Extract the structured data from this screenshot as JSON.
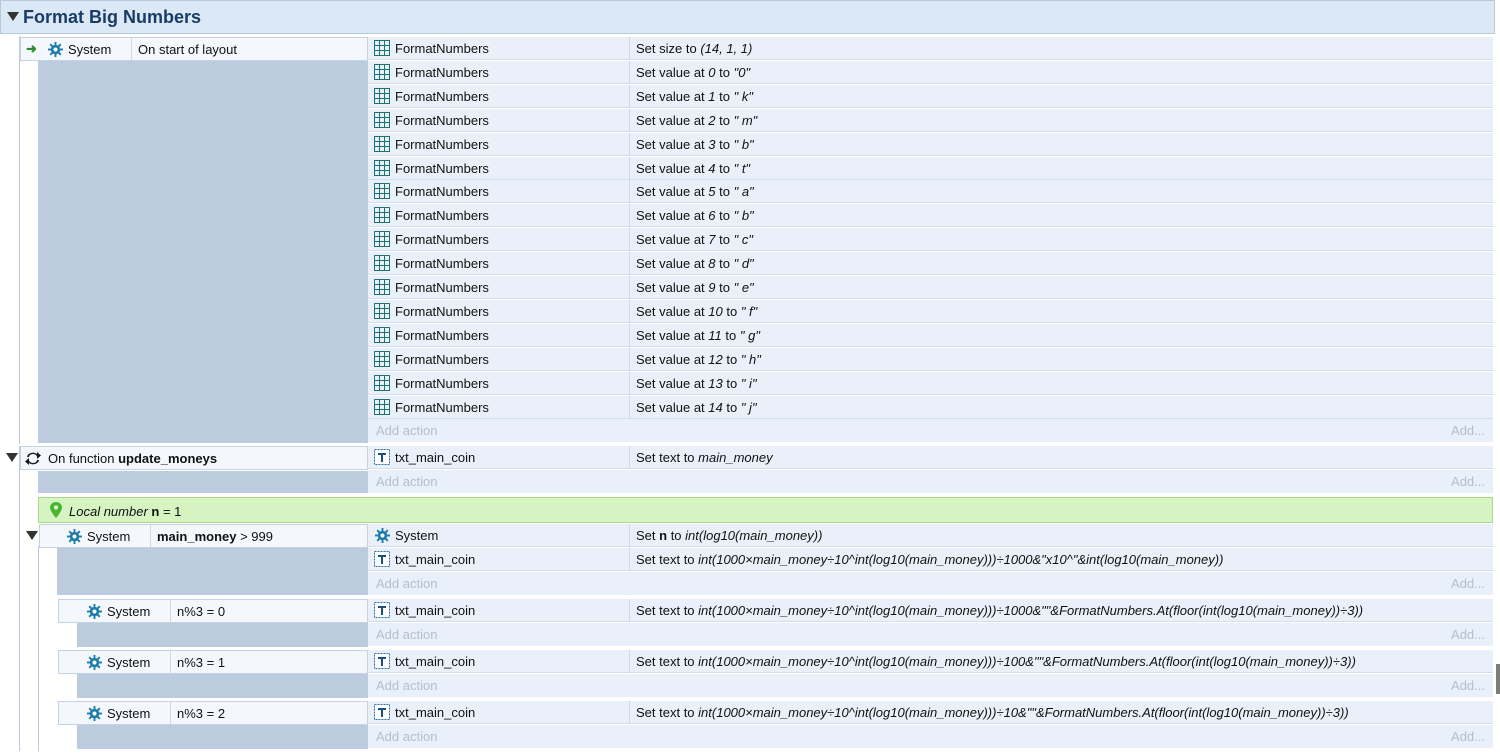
{
  "group": {
    "title": "Format Big Numbers"
  },
  "event1": {
    "object": "System",
    "condition": "On start of layout",
    "actions": [
      {
        "object": "FormatNumbers",
        "pre": "Set size to ",
        "expr": "(14, 1, 1)",
        "post": ""
      },
      {
        "object": "FormatNumbers",
        "pre": "Set value at ",
        "expr": "0",
        "mid": " to ",
        "val": "\"0\""
      },
      {
        "object": "FormatNumbers",
        "pre": "Set value at ",
        "expr": "1",
        "mid": " to ",
        "val": "\" k\""
      },
      {
        "object": "FormatNumbers",
        "pre": "Set value at ",
        "expr": "2",
        "mid": " to ",
        "val": "\" m\""
      },
      {
        "object": "FormatNumbers",
        "pre": "Set value at ",
        "expr": "3",
        "mid": " to ",
        "val": "\" b\""
      },
      {
        "object": "FormatNumbers",
        "pre": "Set value at ",
        "expr": "4",
        "mid": " to ",
        "val": "\" t\""
      },
      {
        "object": "FormatNumbers",
        "pre": "Set value at ",
        "expr": "5",
        "mid": " to ",
        "val": "\" a\""
      },
      {
        "object": "FormatNumbers",
        "pre": "Set value at ",
        "expr": "6",
        "mid": " to ",
        "val": "\" b\""
      },
      {
        "object": "FormatNumbers",
        "pre": "Set value at ",
        "expr": "7",
        "mid": " to ",
        "val": "\" c\""
      },
      {
        "object": "FormatNumbers",
        "pre": "Set value at ",
        "expr": "8",
        "mid": " to ",
        "val": "\" d\""
      },
      {
        "object": "FormatNumbers",
        "pre": "Set value at ",
        "expr": "9",
        "mid": " to ",
        "val": "\" e\""
      },
      {
        "object": "FormatNumbers",
        "pre": "Set value at ",
        "expr": "10",
        "mid": " to ",
        "val": "\" f\""
      },
      {
        "object": "FormatNumbers",
        "pre": "Set value at ",
        "expr": "11",
        "mid": " to ",
        "val": "\" g\""
      },
      {
        "object": "FormatNumbers",
        "pre": "Set value at ",
        "expr": "12",
        "mid": " to ",
        "val": "\" h\""
      },
      {
        "object": "FormatNumbers",
        "pre": "Set value at ",
        "expr": "13",
        "mid": " to ",
        "val": "\" i\""
      },
      {
        "object": "FormatNumbers",
        "pre": "Set value at ",
        "expr": "14",
        "mid": " to ",
        "val": "\" j\""
      }
    ]
  },
  "labels": {
    "add_action": "Add action",
    "add": "Add..."
  },
  "event2": {
    "prefix": "On function ",
    "name": "update_moneys",
    "action_object": "txt_main_coin",
    "action_pre": "Set text to ",
    "action_expr": "main_money"
  },
  "local_var": {
    "prefix": "Local number ",
    "name": "n",
    "suffix": " = 1"
  },
  "event3": {
    "object": "System",
    "cond_var": "main_money",
    "cond_rest": " > 999",
    "a1_object": "System",
    "a1_pre": "Set ",
    "a1_var": "n",
    "a1_mid": " to ",
    "a1_expr": "int(log10(main_money))",
    "a2_object": "txt_main_coin",
    "a2_pre": "Set text to ",
    "a2_expr": "int(1000×main_money÷10^int(log10(main_money)))÷1000&\"x10^\"&int(log10(main_money))"
  },
  "sub_events": [
    {
      "object": "System",
      "condition": "n%3 = 0",
      "action_object": "txt_main_coin",
      "action_pre": "Set text to ",
      "action_expr": "int(1000×main_money÷10^int(log10(main_money)))÷1000&\"\"&FormatNumbers.At(floor(int(log10(main_money))÷3))"
    },
    {
      "object": "System",
      "condition": "n%3 = 1",
      "action_object": "txt_main_coin",
      "action_pre": "Set text to ",
      "action_expr": "int(1000×main_money÷10^int(log10(main_money)))÷100&\"\"&FormatNumbers.At(floor(int(log10(main_money))÷3))"
    },
    {
      "object": "System",
      "condition": "n%3 = 2",
      "action_object": "txt_main_coin",
      "action_pre": "Set text to ",
      "action_expr": "int(1000×main_money÷10^int(log10(main_money)))÷10&\"\"&FormatNumbers.At(floor(int(log10(main_money))÷3))"
    }
  ]
}
